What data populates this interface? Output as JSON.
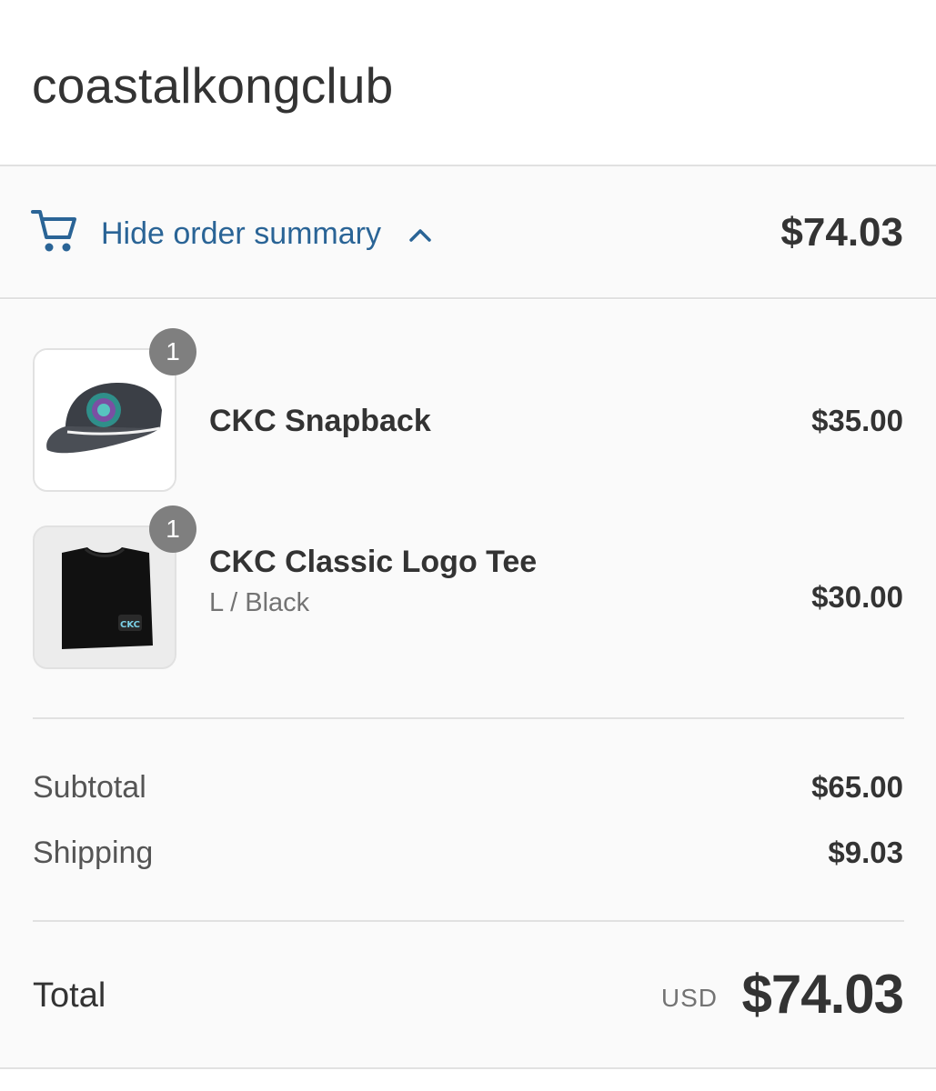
{
  "store": {
    "name": "coastalkongclub"
  },
  "summary_toggle": {
    "label": "Hide order summary",
    "total": "$74.03",
    "icon": "cart-icon",
    "chevron": "chevron-up-icon",
    "accent_color": "#2a6496"
  },
  "line_items": [
    {
      "name": "CKC Snapback",
      "variant": "",
      "price": "$35.00",
      "quantity": "1",
      "image_icon": "snapback-cap-image"
    },
    {
      "name": "CKC Classic Logo Tee",
      "variant": "L / Black",
      "price": "$30.00",
      "quantity": "1",
      "image_icon": "folded-tee-image"
    }
  ],
  "totals": {
    "subtotal_label": "Subtotal",
    "subtotal_value": "$65.00",
    "shipping_label": "Shipping",
    "shipping_value": "$9.03",
    "total_label": "Total",
    "currency": "USD",
    "total_value": "$74.03"
  },
  "colors": {
    "panel_background": "#fafafa",
    "border": "#e1e1e1",
    "badge": "#7f7f7f",
    "text": "#333333",
    "muted_text": "#737373"
  }
}
